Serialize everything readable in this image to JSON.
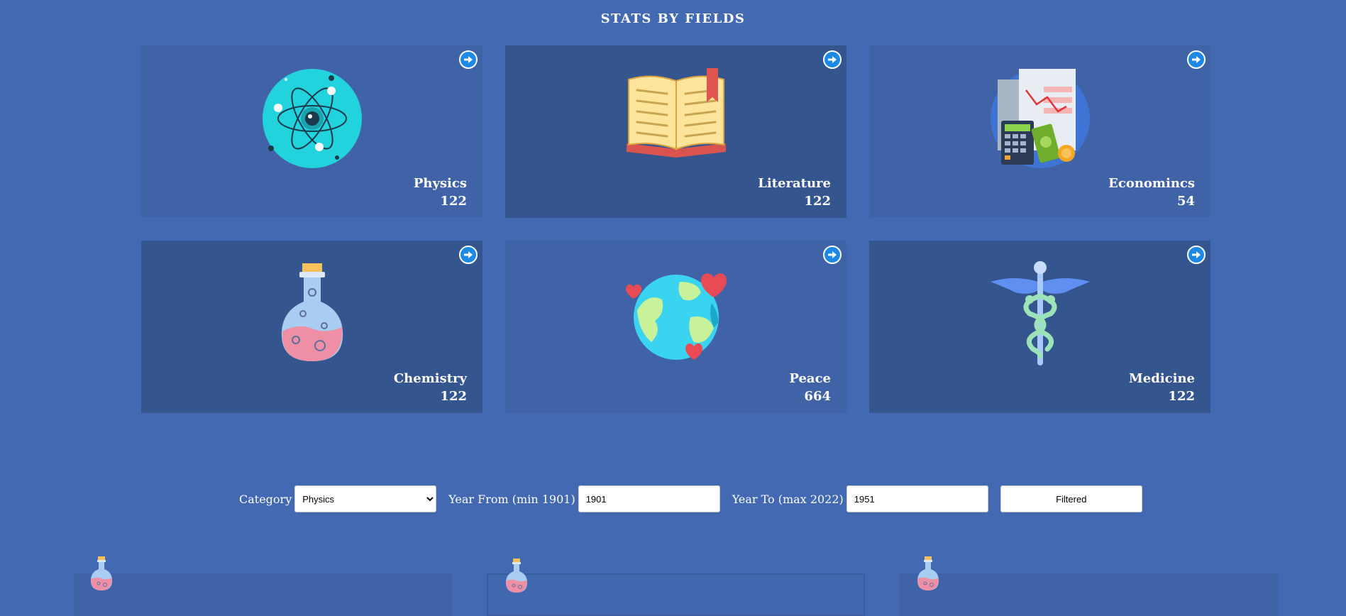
{
  "page": {
    "title": "STATS BY FIELDS",
    "background": "#4369b2"
  },
  "cards": [
    {
      "label": "Physics",
      "count": "122",
      "icon": "atom-icon",
      "tone": "light"
    },
    {
      "label": "Literature",
      "count": "122",
      "icon": "book-icon",
      "tone": "dark"
    },
    {
      "label": "Economincs",
      "count": "54",
      "icon": "economics-icon",
      "tone": "light"
    },
    {
      "label": "Chemistry",
      "count": "122",
      "icon": "flask-icon",
      "tone": "dark"
    },
    {
      "label": "Peace",
      "count": "664",
      "icon": "globe-hearts-icon",
      "tone": "light"
    },
    {
      "label": "Medicine",
      "count": "122",
      "icon": "caduceus-icon",
      "tone": "dark"
    }
  ],
  "filters": {
    "category_label": "Category",
    "category_value": "Physics",
    "category_options": [
      "Physics"
    ],
    "year_from_label": "Year From (min 1901)",
    "year_from_value": "1901",
    "year_to_label": "Year To (max 2022)",
    "year_to_value": "1951",
    "submit_label": "Filtered"
  },
  "colors": {
    "card_light": "#4063a8",
    "card_dark": "#35558f",
    "arrow_button": "#1e88e5"
  }
}
